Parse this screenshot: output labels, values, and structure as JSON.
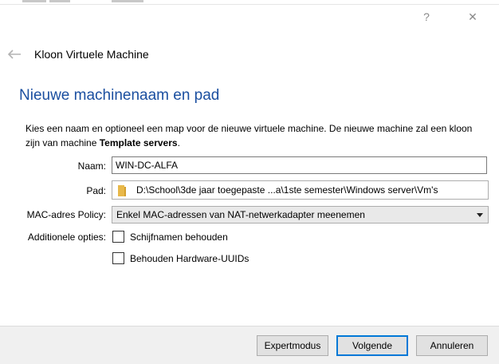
{
  "window": {
    "help_glyph": "?",
    "close_glyph": "✕"
  },
  "wizard": {
    "title": "Kloon Virtuele Machine",
    "page_title": "Nieuwe machinenaam en pad",
    "description_prefix": "Kies een naam en optioneel een map voor de nieuwe virtuele machine. De nieuwe machine zal een kloon zijn van machine ",
    "source_machine": "Template servers",
    "description_suffix": "."
  },
  "form": {
    "name_label": "Naam:",
    "name_value": "WIN-DC-ALFA",
    "path_label": "Pad:",
    "path_value": "D:\\School\\3de jaar toegepaste ...a\\1ste semester\\Windows server\\Vm's",
    "mac_label": "MAC-adres Policy:",
    "mac_value": "Enkel MAC-adressen van NAT-netwerkadapter meenemen",
    "options_label": "Additionele opties:",
    "options": [
      {
        "label": "Schijfnamen behouden",
        "checked": false
      },
      {
        "label": "Behouden Hardware-UUIDs",
        "checked": false
      }
    ]
  },
  "footer": {
    "expert_label": "Expertmodus",
    "next_label": "Volgende",
    "cancel_label": "Annuleren"
  },
  "colors": {
    "page_title": "#1b4fa0",
    "focus_border": "#0078d7",
    "folder": "#e8b84a",
    "footer_bg": "#f0f0f0"
  },
  "icons": {
    "back": "back-arrow-icon",
    "path": "folder-icon",
    "dropdown": "chevron-down-icon"
  }
}
